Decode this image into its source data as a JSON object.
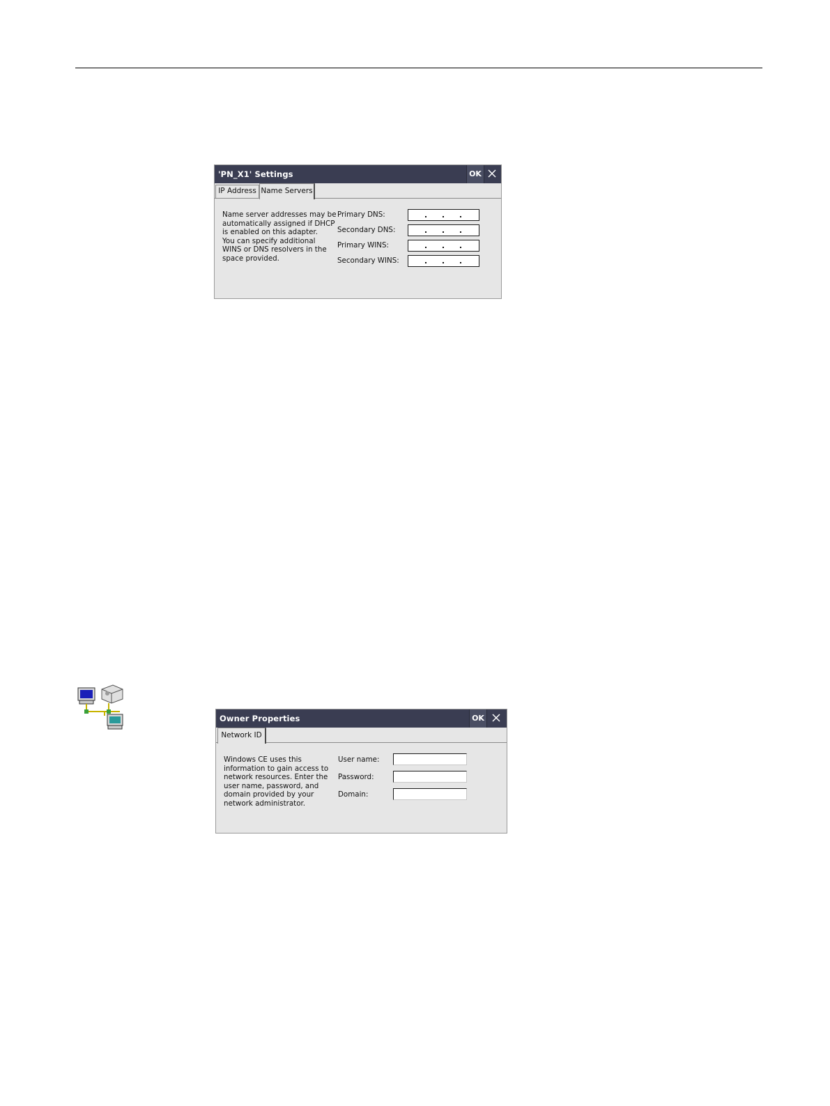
{
  "dialog1": {
    "title": "'PN_X1' Settings",
    "ok_label": "OK",
    "tabs": [
      {
        "label": "IP Address",
        "active": false
      },
      {
        "label": "Name Servers",
        "active": true
      }
    ],
    "description_lines": [
      "Name server addresses may be",
      "automatically assigned if DHCP",
      "is enabled on this adapter.",
      "You can specify additional",
      "WINS or DNS resolvers in the",
      "space provided."
    ],
    "fields": [
      {
        "label": "Primary DNS:",
        "value": ""
      },
      {
        "label": "Secondary DNS:",
        "value": ""
      },
      {
        "label": "Primary WINS:",
        "value": ""
      },
      {
        "label": "Secondary WINS:",
        "value": ""
      }
    ]
  },
  "dialog2": {
    "title": "Owner Properties",
    "ok_label": "OK",
    "tabs": [
      {
        "label": "Network ID",
        "active": true
      }
    ],
    "description_lines": [
      "Windows CE uses this",
      "information to gain access to",
      "network resources. Enter the",
      "user name, password, and",
      "domain provided by your",
      "network administrator."
    ],
    "fields": [
      {
        "label": "User name:",
        "value": ""
      },
      {
        "label": "Password:",
        "value": ""
      },
      {
        "label": "Domain:",
        "value": ""
      }
    ]
  },
  "icons": {
    "network_icon": "network-computers-icon",
    "close_icon": "close-icon"
  },
  "colors": {
    "titlebar": "#3a3d52",
    "dialog_background": "#e6e6e6"
  }
}
